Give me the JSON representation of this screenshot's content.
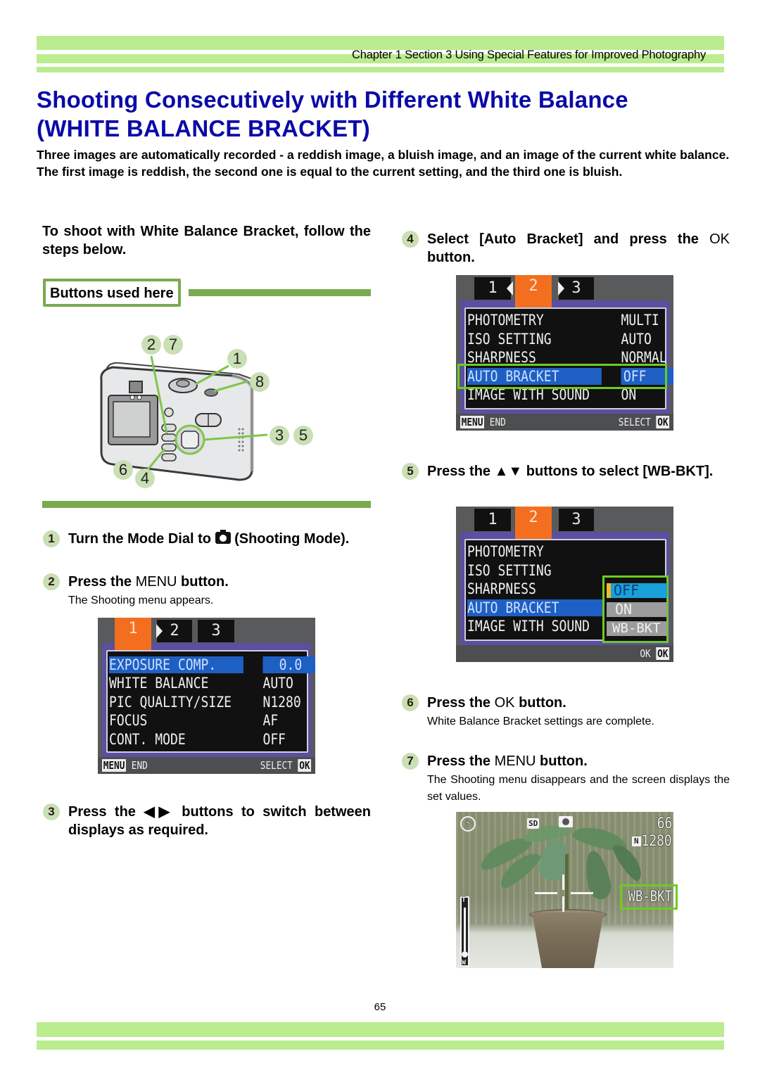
{
  "header": {
    "chapter_text": "Chapter 1 Section 3 Using Special Features for Improved Photography"
  },
  "title": {
    "line1": "Shooting Consecutively with Different White Balance",
    "line2": "(WHITE BALANCE BRACKET)"
  },
  "intro": {
    "p1": "Three images are automatically recorded - a reddish image, a bluish image, and an image of the current white balance.",
    "p2": "The first image is reddish, the second one is equal to the current setting, and the third one is bluish."
  },
  "lead": "To shoot with White Balance Bracket, follow the steps below.",
  "buttons_used": {
    "label": "Buttons used here",
    "callouts": [
      "2",
      "7",
      "1",
      "8",
      "3",
      "5",
      "6",
      "4"
    ]
  },
  "steps": [
    {
      "num": "1",
      "text_before": "Turn the Mode Dial to ",
      "icon": "camera-icon",
      "text_after": " (Shooting Mode)."
    },
    {
      "num": "2",
      "text_before": "Press the ",
      "key": "MENU",
      "text_after": " button.",
      "sub": "The Shooting menu appears."
    },
    {
      "num": "3",
      "text_before": "Press the ",
      "key": "◀▶",
      "text_after": " buttons to switch between displays as required."
    },
    {
      "num": "4",
      "text_before": "Select [Auto Bracket] and press the ",
      "key": "OK",
      "text_after": " button."
    },
    {
      "num": "5",
      "text_before": "Press the ",
      "key": "▲▼",
      "text_after": " buttons to select [WB-BKT]."
    },
    {
      "num": "6",
      "text_before": "Press the ",
      "key": "OK",
      "text_after": " button.",
      "sub": "White Balance Bracket settings are complete."
    },
    {
      "num": "7",
      "text_before": "Press the ",
      "key": "MENU",
      "text_after": " button.",
      "sub": "The Shooting menu disappears and the screen displays the set values."
    }
  ],
  "screens": {
    "menu1": {
      "tabs": [
        "1",
        "2",
        "3"
      ],
      "active_tab": "1",
      "rows": [
        {
          "label": "EXPOSURE COMP.",
          "value": "0.0",
          "highlighted": true
        },
        {
          "label": "WHITE BALANCE",
          "value": "AUTO"
        },
        {
          "label": "PIC QUALITY/SIZE",
          "value": "N1280"
        },
        {
          "label": "FOCUS",
          "value": "AF"
        },
        {
          "label": "CONT. MODE",
          "value": "OFF"
        }
      ],
      "footer_left_key": "MENU",
      "footer_left_text": "END",
      "footer_right_text": "SELECT",
      "footer_right_key": "OK"
    },
    "menu2": {
      "tabs": [
        "1",
        "2",
        "3"
      ],
      "active_tab": "2",
      "rows": [
        {
          "label": "PHOTOMETRY",
          "value": "MULTI"
        },
        {
          "label": "ISO SETTING",
          "value": "AUTO"
        },
        {
          "label": "SHARPNESS",
          "value": "NORMAL"
        },
        {
          "label": "AUTO BRACKET",
          "value": "OFF",
          "highlighted": true
        },
        {
          "label": "IMAGE WITH SOUND",
          "value": "ON"
        }
      ],
      "footer_left_key": "MENU",
      "footer_left_text": "END",
      "footer_right_text": "SELECT",
      "footer_right_key": "OK"
    },
    "menu3": {
      "tabs": [
        "1",
        "2",
        "3"
      ],
      "active_tab": "2",
      "rows": [
        {
          "label": "PHOTOMETRY"
        },
        {
          "label": "ISO SETTING"
        },
        {
          "label": "SHARPNESS"
        },
        {
          "label": "AUTO BRACKET",
          "highlighted": true
        },
        {
          "label": "IMAGE WITH SOUND"
        }
      ],
      "options": [
        "OFF",
        "ON",
        "WB-BKT"
      ],
      "selected_option": "OFF",
      "footer_right_text": "OK",
      "footer_right_key": "OK"
    },
    "liveview": {
      "flash_icon": "flash-auto-icon",
      "media": "SD",
      "mode_icon": "camera-icon",
      "shots_remaining": "66",
      "quality_badge": "N",
      "size": "1280",
      "wb_bracket": "WB-BKT",
      "zoom_top": "T",
      "zoom_bottom": "W"
    }
  },
  "footer": {
    "page_number": "65"
  },
  "colors": {
    "band": "#bbec8f",
    "accent_green": "#7aab4f",
    "title_blue": "#0a0aa8",
    "step_circle": "#c9dfb4",
    "lcd_highlight": "#1e5fc4",
    "lcd_tab_active": "#f36f1f",
    "callout_box": "#6dcc1f"
  }
}
